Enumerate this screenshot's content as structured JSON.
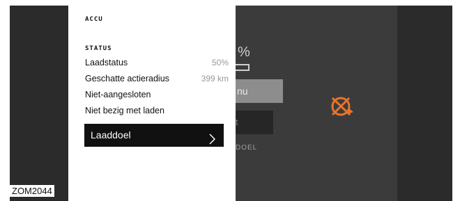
{
  "figure_id": "ZOM2044",
  "panel": {
    "title": "ACCU",
    "section_title": "STATUS",
    "rows": [
      {
        "label": "Laadstatus",
        "value": "50%"
      },
      {
        "label": "Geschatte actieradius",
        "value": "399 km"
      },
      {
        "label": "Niet-aangesloten",
        "value": ""
      },
      {
        "label": "Niet bezig met laden",
        "value": ""
      }
    ],
    "button_label": "Laaddoel"
  },
  "background": {
    "percent_fragment": "%",
    "menu_fragment": "nu",
    "button_fragment": "t",
    "caption_fragment": "DOEL",
    "icon": "charging-crossed-icon",
    "accent_color": "#e8742b"
  }
}
